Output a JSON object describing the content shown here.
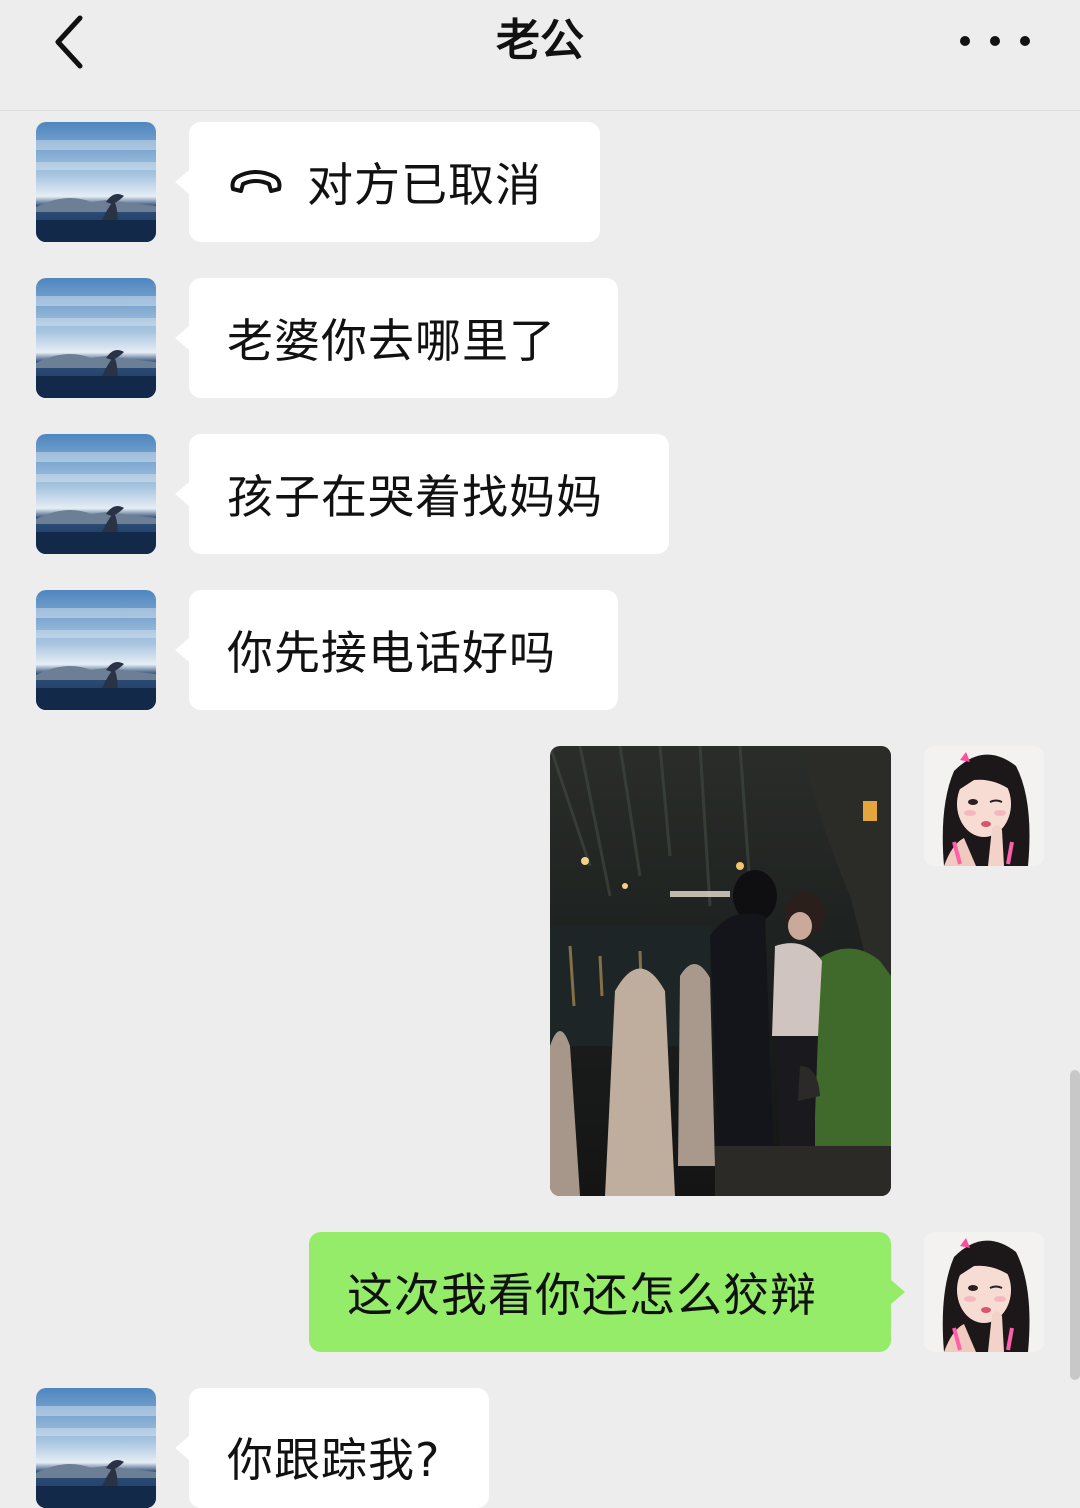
{
  "header": {
    "title": "老公",
    "back_icon": "chevron-left-icon",
    "more_icon": "more-dots-icon"
  },
  "contact": {
    "avatar_icon": "avatar-ocean-whale-tail"
  },
  "me": {
    "avatar_icon": "avatar-girl-pink"
  },
  "messages": [
    {
      "from": "contact",
      "type": "call",
      "icon": "phone-hangup-icon",
      "text": "对方已取消"
    },
    {
      "from": "contact",
      "type": "text",
      "text": "老婆你去哪里了"
    },
    {
      "from": "contact",
      "type": "text",
      "text": "孩子在哭着找妈妈"
    },
    {
      "from": "contact",
      "type": "text",
      "text": "你先接电话好吗"
    },
    {
      "from": "me",
      "type": "image",
      "image": "night-street-couple-photo"
    },
    {
      "from": "me",
      "type": "text",
      "text": "这次我看你还怎么狡辩"
    },
    {
      "from": "contact",
      "type": "text",
      "text": "你跟踪我?"
    }
  ],
  "colors": {
    "background": "#ededed",
    "incoming_bubble": "#ffffff",
    "outgoing_bubble": "#95ec69"
  }
}
